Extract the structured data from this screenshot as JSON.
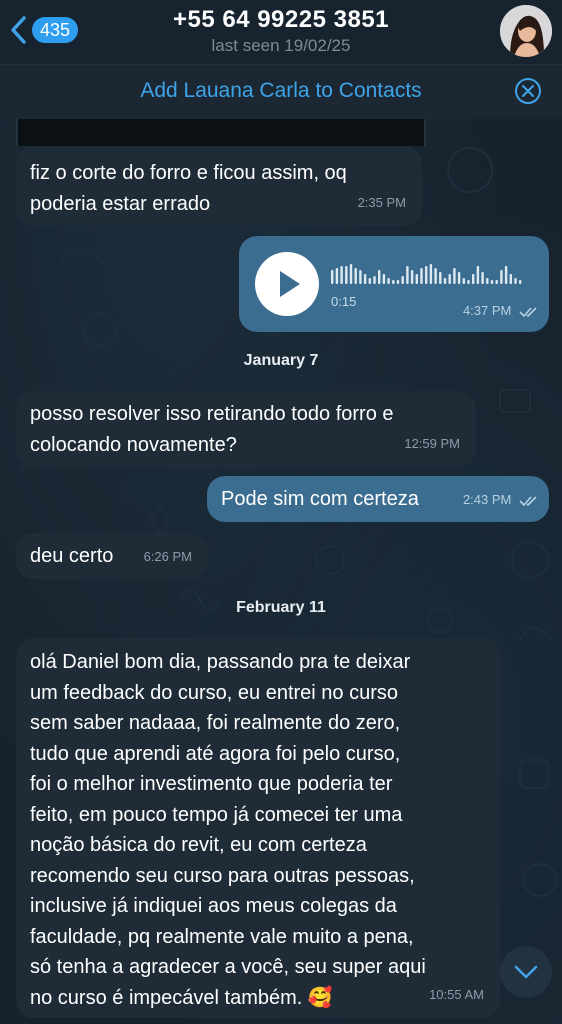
{
  "header": {
    "back_count": "435",
    "title": "+55 64 99225 3851",
    "subtitle": "last seen 19/02/25"
  },
  "add_contact_bar": {
    "label": "Add Lauana Carla to Contacts"
  },
  "messages": [
    {
      "type": "in",
      "text_lines": [
        "fiz o corte do forro e ficou assim, oq",
        "poderia estar errado"
      ],
      "time": "2:35 PM"
    },
    {
      "type": "out-voice",
      "duration": "0:15",
      "time": "4:37 PM"
    },
    {
      "type": "date",
      "label": "January 7"
    },
    {
      "type": "in",
      "text_lines": [
        "posso resolver isso retirando todo forro e",
        "colocando novamente?"
      ],
      "time": "12:59 PM"
    },
    {
      "type": "out",
      "text": "Pode sim com certeza",
      "time": "2:43 PM"
    },
    {
      "type": "in",
      "text": "deu certo",
      "time": "6:26 PM"
    },
    {
      "type": "date",
      "label": "February 11"
    },
    {
      "type": "in",
      "text_lines": [
        "olá Daniel bom dia, passando pra te deixar",
        "um feedback do curso, eu entrei no curso",
        "sem saber nadaaa, foi realmente do zero,",
        "tudo que aprendi até agora foi pelo curso,",
        "foi o melhor investimento que poderia ter",
        "feito, em pouco tempo já comecei ter uma",
        "noção básica do revit, eu com certeza",
        "recomendo seu curso para outras pessoas,",
        "inclusive já indiquei aos meus colegas da",
        "faculdade, pq realmente vale muito a pena,",
        "só tenha a agradecer a você, seu super aqui",
        "no curso é impecável também. 🥰"
      ],
      "time": "10:55 AM"
    }
  ],
  "colors": {
    "accent": "#3fa3e8",
    "outgoing_bubble": "#3b6d90",
    "incoming_bubble": "#1f2c38",
    "background": "#16222d"
  }
}
